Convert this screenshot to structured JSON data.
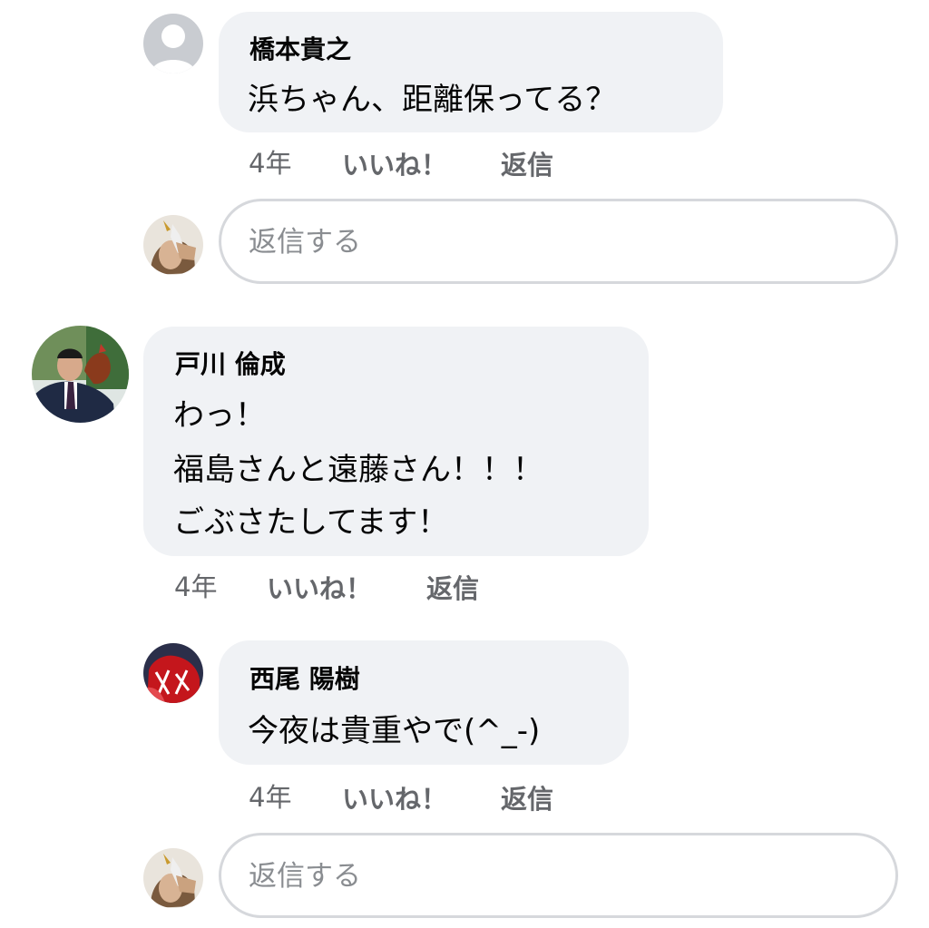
{
  "comments": [
    {
      "author": "橋本貴之",
      "lines": [
        "浜ちゃん、距離保ってる？"
      ],
      "meta": {
        "time": "4年",
        "like": "いいね！",
        "reply": "返信"
      },
      "avatar": "default-avatar"
    },
    {
      "author": "戸川 倫成",
      "lines": [
        "わっ！",
        "福島さんと遠藤さん！！！",
        "ごぶさたしてます！"
      ],
      "meta": {
        "time": "4年",
        "like": "いいね！",
        "reply": "返信"
      },
      "avatar": "photo-avatar"
    },
    {
      "author": "西尾 陽樹",
      "lines": [
        "今夜は貴重やで(^_-)"
      ],
      "meta": {
        "time": "4年",
        "like": "いいね！",
        "reply": "返信"
      },
      "avatar": "photo-avatar"
    }
  ],
  "reply_inputs": [
    {
      "placeholder": "返信する"
    },
    {
      "placeholder": "返信する"
    }
  ],
  "colors": {
    "bubble": "#f0f2f5",
    "meta_text": "#65676b",
    "placeholder": "#8a8d91",
    "input_border": "#d6d8dc"
  }
}
